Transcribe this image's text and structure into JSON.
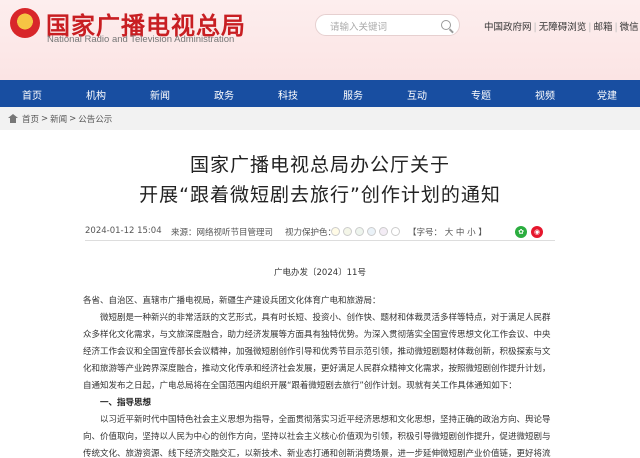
{
  "header": {
    "title": "国家广播电视总局",
    "subtitle": "National Radio and Television Administration",
    "search_placeholder": "请输入关键词",
    "links": [
      "中国政府网",
      "无障碍浏览",
      "邮箱",
      "微信"
    ]
  },
  "nav": {
    "items": [
      "首页",
      "机构",
      "新闻",
      "政务",
      "科技",
      "服务",
      "互动",
      "专题",
      "视频",
      "党建"
    ]
  },
  "breadcrumb": [
    "首页",
    "新闻",
    "公告公示"
  ],
  "article": {
    "title_line1": "国家广播电视总局办公厅关于",
    "title_line2": "开展“跟着微短剧去旅行”创作计划的通知",
    "date": "2024-01-12 15:04",
    "source": "来源：网络视听节目管理司",
    "eye_label": "视力保护色：",
    "font_label": "【字号： 大 中 小 】",
    "doc_no": "广电办发〔2024〕11号",
    "paragraphs": [
      "各省、自治区、直辖市广播电视局，新疆生产建设兵团文化体育广电和旅游局：",
      "　　微短剧是一种新兴的非常活跃的文艺形式，具有时长短、投资小、创作快、题材和体裁灵活多样等特点，对于满足人民群",
      "众多样化文化需求，与文旅深度融合，助力经济发展等方面具有独特优势。为深入贯彻落实全国宣传思想文化工作会议、中央",
      "经济工作会议和全国宣传部长会议精神，加强微短剧创作引导和优秀节目示范引领，推动微短剧题材体裁创新，积极探索与文",
      "化和旅游等产业跨界深度融合，推动文化传承和经济社会发展，更好满足人民群众精神文化需求，按照微短剧创作提升计划，",
      "自通知发布之日起，广电总局将在全国范围内组织开展“跟着微短剧去旅行”创作计划。现就有关工作具体通知如下：",
      "　　一、指导思想",
      "　　以习近平新时代中国特色社会主义思想为指导，全面贯彻落实习近平经济思想和文化思想，坚持正确的政治方向、舆论导",
      "向、价值取向，坚持以人民为中心的创作方向，坚持以社会主义核心价值观为引领，积极引导微短剧创作提升，促进微短剧与",
      "传统文化、旅游资源、线下经济交融交汇，以新技术、新业态打通和创新消费场景，进一步延伸微短剧产业价值链，更好将流"
    ]
  },
  "colors": {
    "brand_red": "#c81e22",
    "nav_blue": "#184ea1",
    "header_pink": "#fbe4e4"
  }
}
